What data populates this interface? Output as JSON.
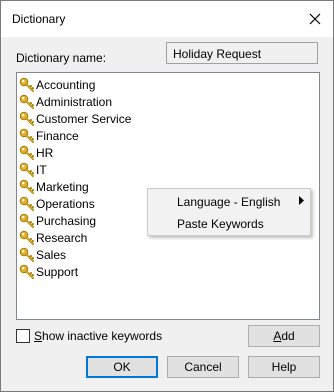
{
  "window": {
    "title": "Dictionary"
  },
  "name_label": "Dictionary name:",
  "name_value": "Holiday Request",
  "items": [
    {
      "label": "Accounting"
    },
    {
      "label": "Administration"
    },
    {
      "label": "Customer Service"
    },
    {
      "label": "Finance"
    },
    {
      "label": "HR"
    },
    {
      "label": "IT"
    },
    {
      "label": "Marketing"
    },
    {
      "label": "Operations"
    },
    {
      "label": "Purchasing"
    },
    {
      "label": "Research"
    },
    {
      "label": "Sales"
    },
    {
      "label": "Support"
    }
  ],
  "context_menu": {
    "language_label": "Language - English",
    "paste_label": "Paste Keywords"
  },
  "show_inactive": {
    "label_first": "S",
    "label_rest": "how inactive keywords",
    "checked": false
  },
  "buttons": {
    "add_first": "A",
    "add_rest": "dd",
    "ok": "OK",
    "cancel": "Cancel",
    "help": "Help"
  },
  "colors": {
    "key_gold": "#e0b030",
    "key_outline": "#a67c00",
    "accent": "#0078d7"
  }
}
